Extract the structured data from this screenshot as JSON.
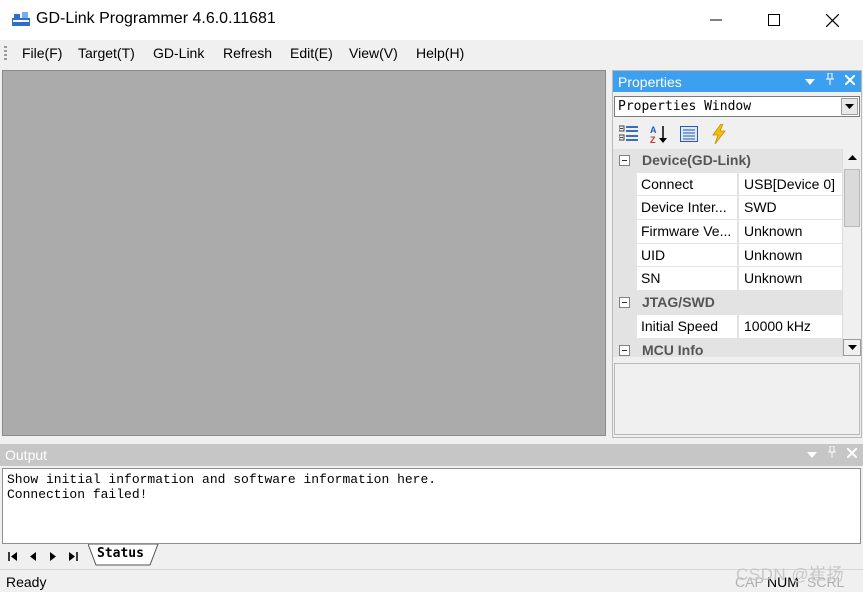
{
  "window": {
    "title": "GD-Link Programmer 4.6.0.11681",
    "app_icon": "gd-link-app-icon",
    "controls": {
      "minimize": "—",
      "maximize": "☐",
      "close": "✕"
    }
  },
  "menu": {
    "items": [
      "File(F)",
      "Target(T)",
      "GD-Link",
      "Refresh",
      "Edit(E)",
      "View(V)",
      "Help(H)"
    ]
  },
  "properties": {
    "title": "Properties",
    "header_icons": [
      "dropdown-arrow-icon",
      "pin-icon",
      "close-icon"
    ],
    "combo_value": "Properties Window",
    "toolbar_icons": [
      "categorized-icon",
      "alphabetical-sort-icon",
      "property-pages-icon",
      "events-icon"
    ],
    "categories": [
      {
        "label": "Device(GD-Link)",
        "rows": [
          {
            "name": "Connect",
            "value": "USB[Device 0]"
          },
          {
            "name": "Device Inter...",
            "value": "SWD"
          },
          {
            "name": "Firmware Ve...",
            "value": "Unknown"
          },
          {
            "name": "UID",
            "value": "Unknown"
          },
          {
            "name": "SN",
            "value": "Unknown"
          }
        ]
      },
      {
        "label": "JTAG/SWD",
        "rows": [
          {
            "name": "Initial Speed",
            "value": "10000 kHz"
          }
        ]
      },
      {
        "label": "MCU Info",
        "rows": []
      }
    ]
  },
  "output": {
    "title": "Output",
    "lines": "Show initial information and software information here.\nConnection failed!",
    "tab_label": "Status"
  },
  "statusbar": {
    "ready": "Ready",
    "indicators": [
      "CAP",
      "NUM",
      "SCRL"
    ],
    "watermark": "CSDN @崔扬"
  },
  "colors": {
    "properties_header": "#3d9ff0",
    "output_header_inactive": "#c6c6c6",
    "client_background": "#ababab"
  }
}
